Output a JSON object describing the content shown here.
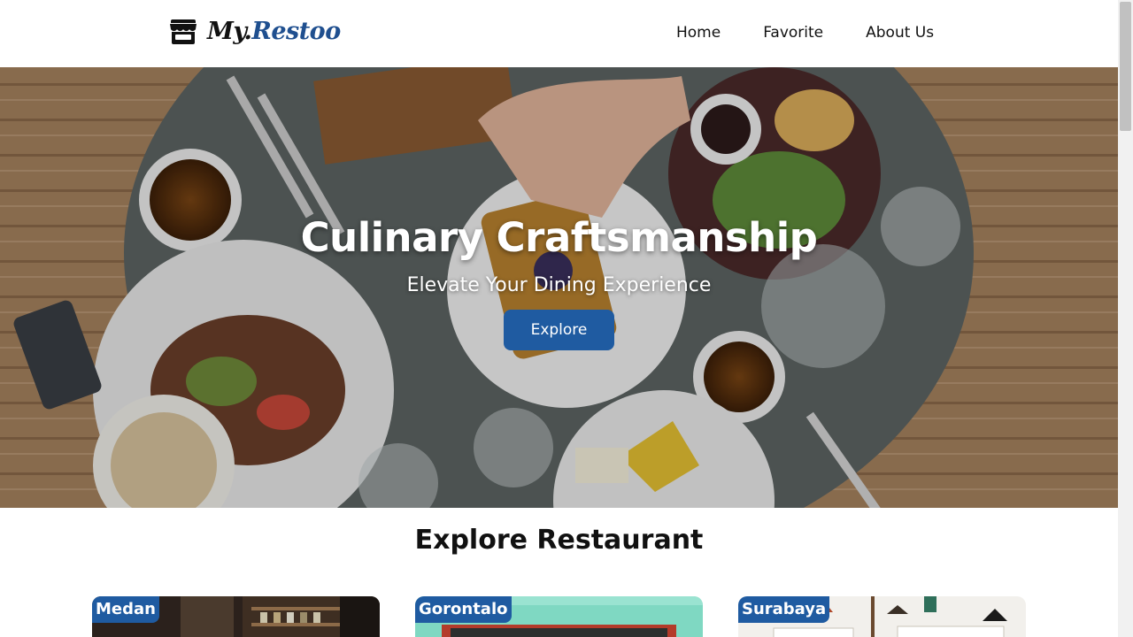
{
  "brand": {
    "prefix": "My.",
    "name": "Restoo",
    "icon": "store-icon"
  },
  "nav": [
    {
      "label": "Home"
    },
    {
      "label": "Favorite"
    },
    {
      "label": "About Us"
    }
  ],
  "hero": {
    "title": "Culinary Craftsmanship",
    "subtitle": "Elevate Your Dining Experience",
    "button_label": "Explore"
  },
  "explore": {
    "title": "Explore Restaurant",
    "cards": [
      {
        "city": "Medan"
      },
      {
        "city": "Gorontalo"
      },
      {
        "city": "Surabaya"
      }
    ]
  },
  "colors": {
    "accent": "#1f5ba1",
    "logo_accent": "#1f4f8f"
  }
}
